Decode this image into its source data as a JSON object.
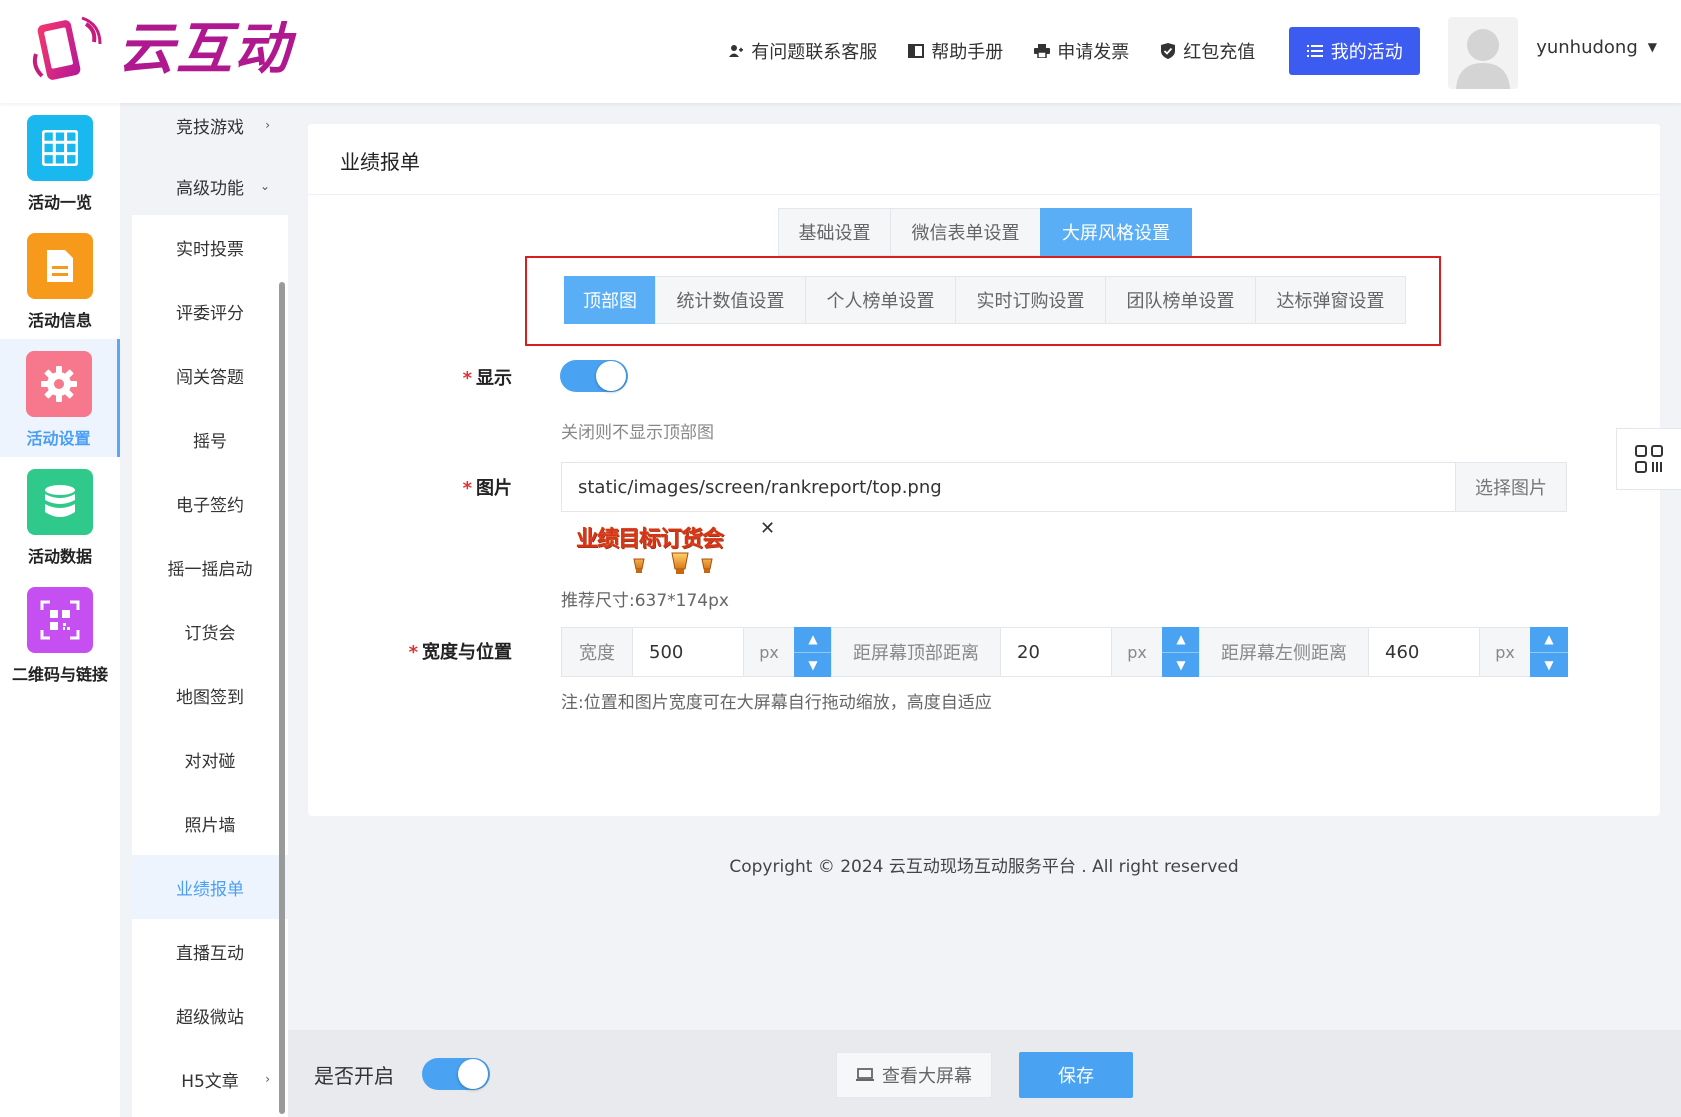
{
  "header": {
    "brand": "云互动",
    "nav": [
      {
        "label": "有问题联系客服",
        "icon": "user-add-icon"
      },
      {
        "label": "帮助手册",
        "icon": "book-icon"
      },
      {
        "label": "申请发票",
        "icon": "printer-icon"
      },
      {
        "label": "红包充值",
        "icon": "shield-check-icon"
      }
    ],
    "my_activity": "我的活动",
    "username": "yunhudong"
  },
  "iconcol": [
    {
      "label": "活动一览",
      "icon": "grid-icon",
      "color": "#19b9ef"
    },
    {
      "label": "活动信息",
      "icon": "document-icon",
      "color": "#f79a1b"
    },
    {
      "label": "活动设置",
      "icon": "gear-icon",
      "color": "#f7778c",
      "active": true
    },
    {
      "label": "活动数据",
      "icon": "database-icon",
      "color": "#2fc98c"
    },
    {
      "label": "二维码与链接",
      "icon": "qrcode-icon",
      "color": "#c54ff0"
    }
  ],
  "submenu": {
    "groups": [
      "竞技游戏",
      "高级功能"
    ],
    "items": [
      "实时投票",
      "评委评分",
      "闯关答题",
      "摇号",
      "电子签约",
      "摇一摇启动",
      "订货会",
      "地图签到",
      "对对碰",
      "照片墙",
      "业绩报单",
      "直播互动",
      "超级微站",
      "H5文章"
    ],
    "active": "业绩报单"
  },
  "card": {
    "title": "业绩报单",
    "tabs": [
      "基础设置",
      "微信表单设置",
      "大屏风格设置"
    ],
    "active_tab": "大屏风格设置",
    "subtabs": [
      "顶部图",
      "统计数值设置",
      "个人榜单设置",
      "实时订购设置",
      "团队榜单设置",
      "达标弹窗设置"
    ],
    "active_subtab": "顶部图",
    "show_label": "显示",
    "show_hint": "关闭则不显示顶部图",
    "image_label": "图片",
    "image_path": "static/images/screen/rankreport/top.png",
    "choose_image": "选择图片",
    "preview_text": "业绩目标订货会",
    "recommended_size": "推荐尺寸:637*174px",
    "size_label": "宽度与位置",
    "width_label": "宽度",
    "width_value": "500",
    "top_label": "距屏幕顶部距离",
    "top_value": "20",
    "left_label": "距屏幕左侧距离",
    "left_value": "460",
    "unit": "px",
    "size_note": "注:位置和图片宽度可在大屏幕自行拖动缩放，高度自适应"
  },
  "copyright": "Copyright © 2024 云互动现场互动服务平台 . All right reserved",
  "bottombar": {
    "enable_label": "是否开启",
    "view_screen": "查看大屏幕",
    "save": "保存"
  }
}
